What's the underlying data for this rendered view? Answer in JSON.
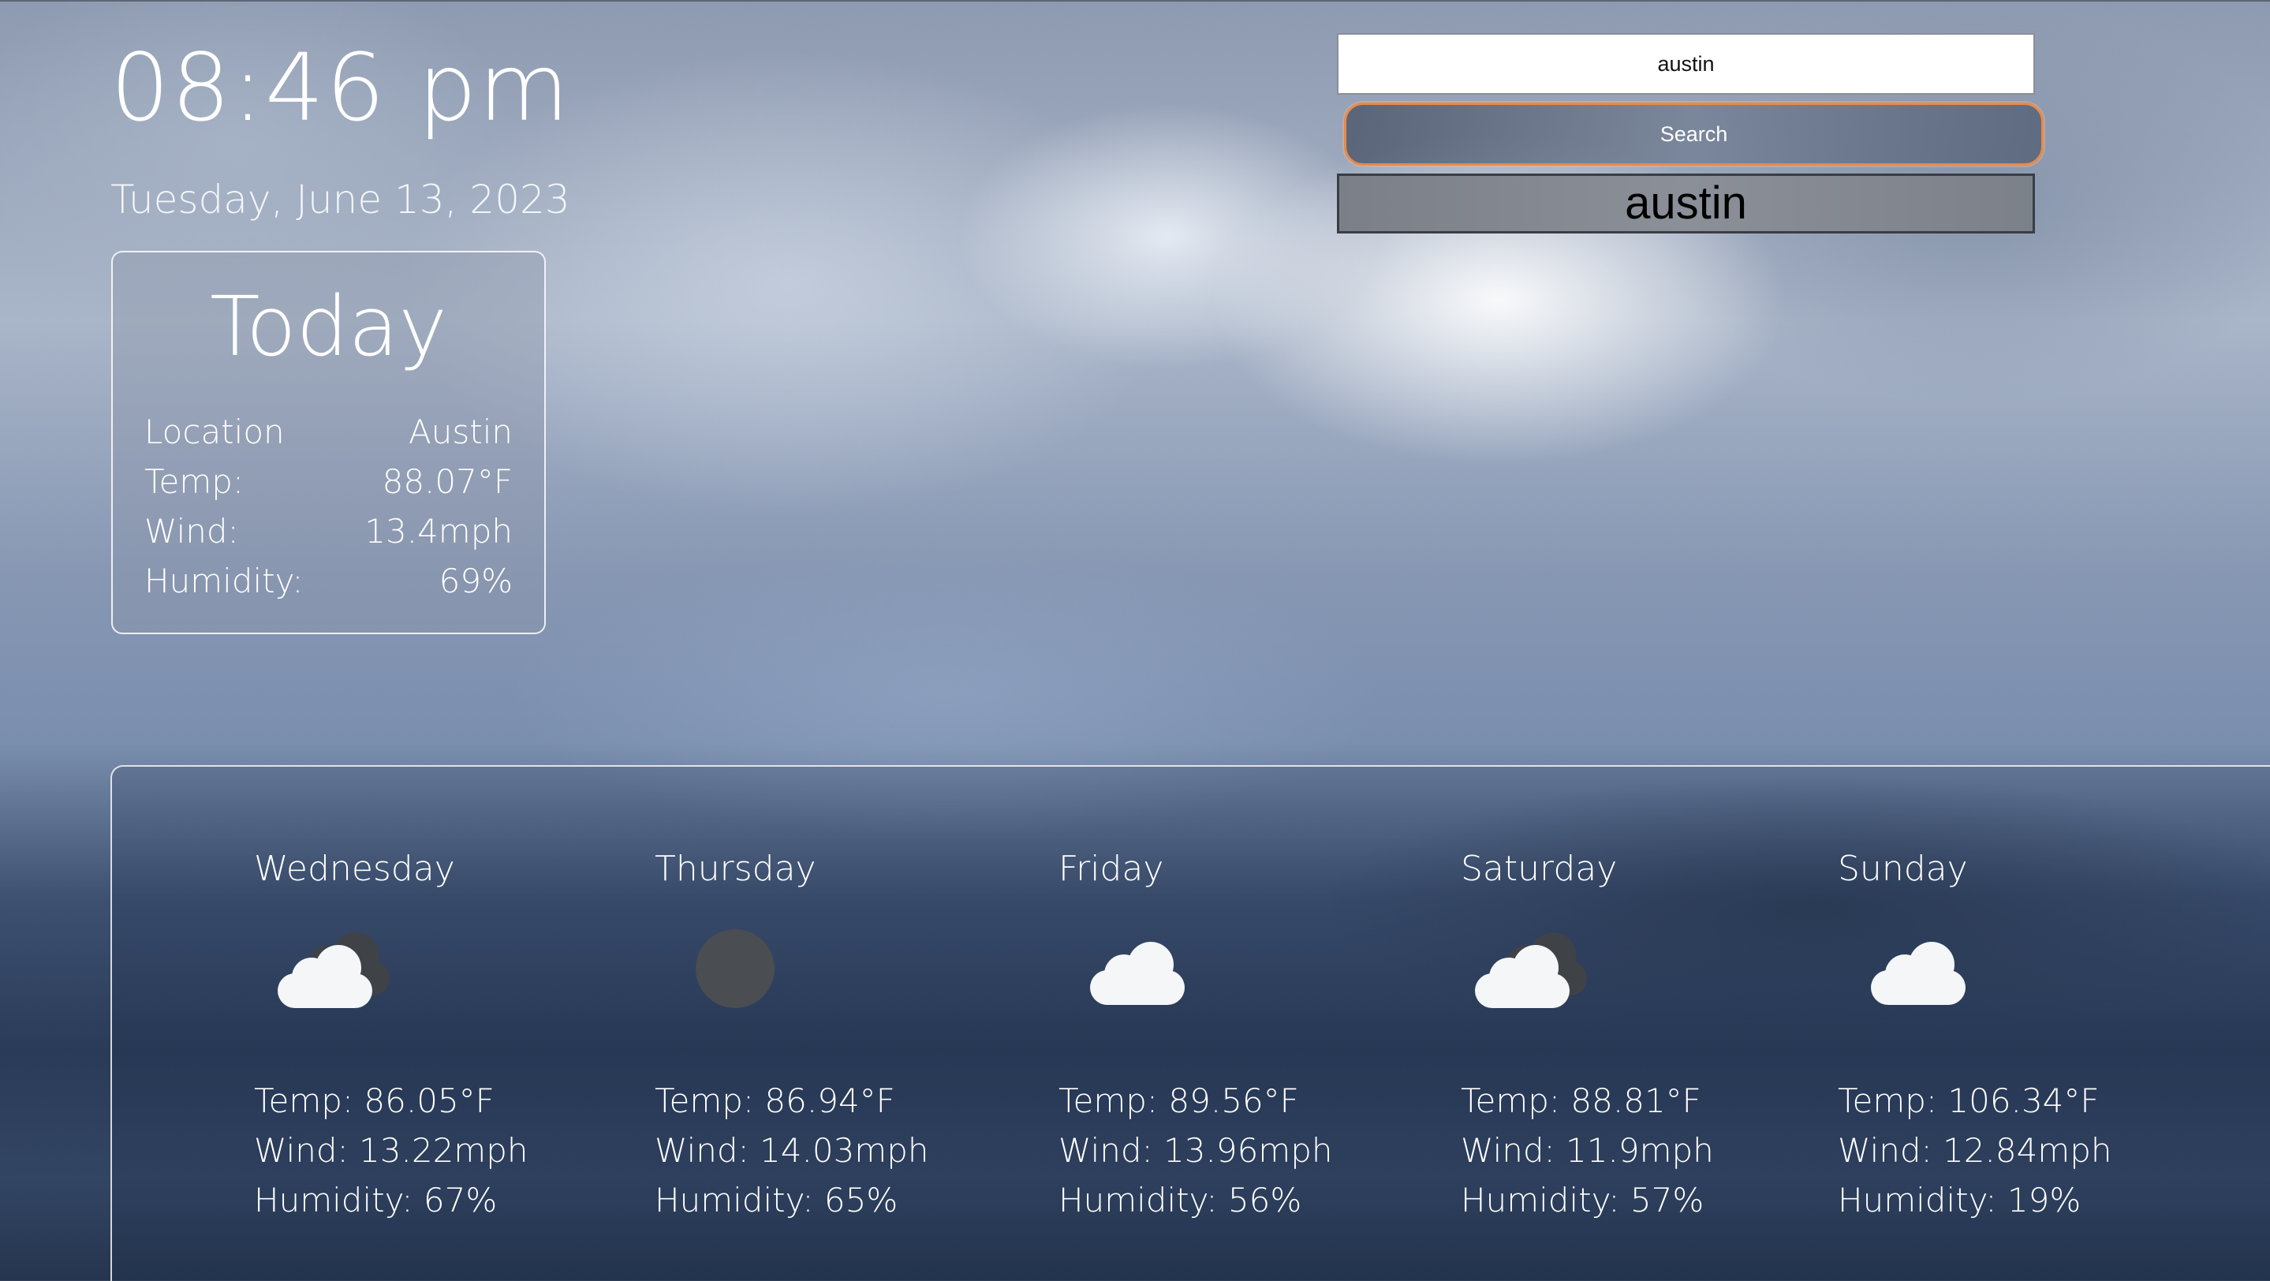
{
  "clock": {
    "time": "08:46 pm",
    "date": "Tuesday, June 13, 2023"
  },
  "today": {
    "title": "Today",
    "rows": [
      {
        "label": "Location",
        "value": "Austin"
      },
      {
        "label": "Temp:",
        "value": "88.07°F"
      },
      {
        "label": "Wind:",
        "value": "13.4mph"
      },
      {
        "label": "Humidity:",
        "value": "69%"
      }
    ]
  },
  "search": {
    "value": "austin",
    "button_label": "Search",
    "history": [
      "austin"
    ]
  },
  "forecast": [
    {
      "day": "Wednesday",
      "icon": "cloud-dark-cloud-icon",
      "temp": "Temp: 86.05°F",
      "wind": "Wind: 13.22mph",
      "humidity": "Humidity: 67%"
    },
    {
      "day": "Thursday",
      "icon": "moon-icon",
      "temp": "Temp: 86.94°F",
      "wind": "Wind: 14.03mph",
      "humidity": "Humidity: 65%"
    },
    {
      "day": "Friday",
      "icon": "cloud-icon",
      "temp": "Temp: 89.56°F",
      "wind": "Wind: 13.96mph",
      "humidity": "Humidity: 56%"
    },
    {
      "day": "Saturday",
      "icon": "cloud-dark-cloud-icon",
      "temp": "Temp: 88.81°F",
      "wind": "Wind: 11.9mph",
      "humidity": "Humidity: 57%"
    },
    {
      "day": "Sunday",
      "icon": "cloud-icon",
      "temp": "Temp: 106.34°F",
      "wind": "Wind: 12.84mph",
      "humidity": "Humidity: 19%"
    }
  ],
  "colors": {
    "button_border": "#e88a4a",
    "history_bg": "#858a92",
    "text": "#ffffff"
  }
}
